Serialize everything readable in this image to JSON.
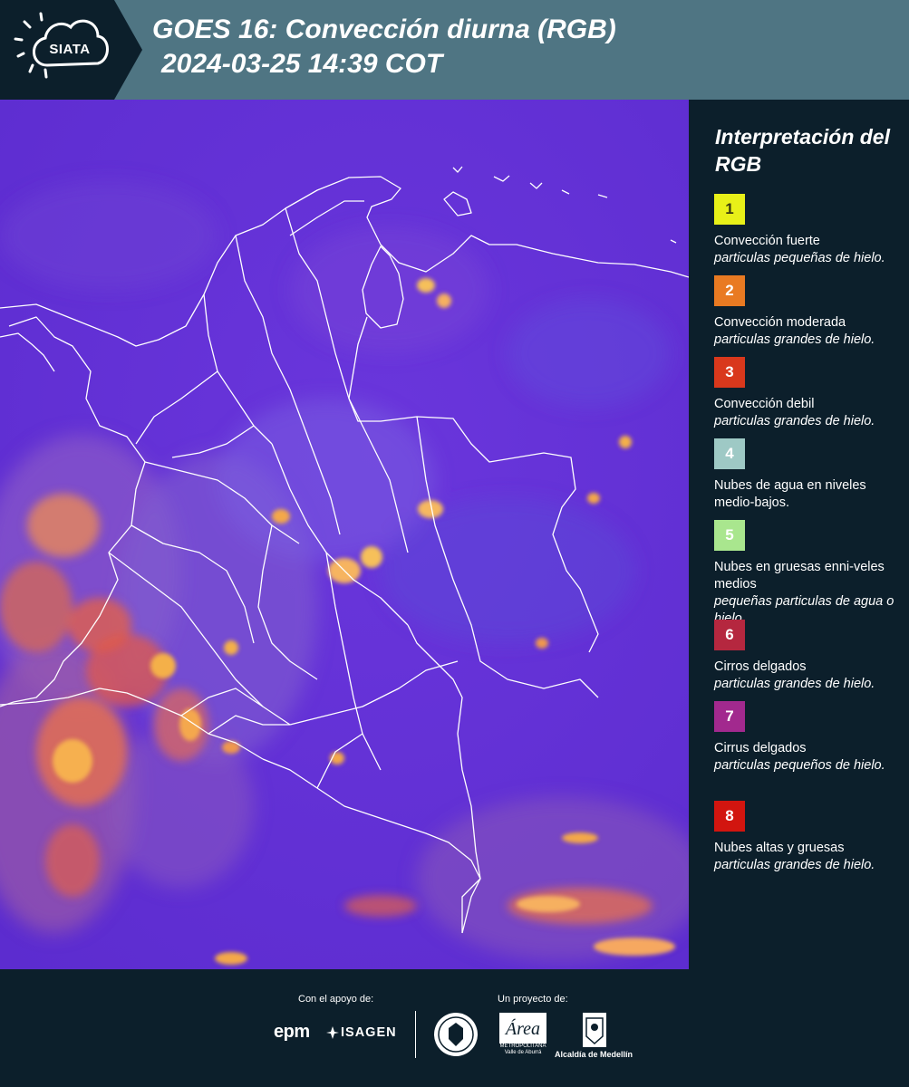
{
  "header": {
    "logo_text": "SIATA",
    "title_line1": "GOES 16: Convección diurna (RGB)",
    "title_line2": "2024-03-25 14:39 COT"
  },
  "map": {
    "background_color": "#6630d8",
    "border_color": "#ffffff",
    "icon": "satellite-rgb-composite-map"
  },
  "legend": {
    "title": "Interpretación del RGB",
    "items": [
      {
        "number": "1",
        "color": "#e8f018",
        "text_color": "#3a3a10",
        "label": "Convección fuerte",
        "sub": "particulas pequeñas de hielo."
      },
      {
        "number": "2",
        "color": "#e97a22",
        "text_color": "#ffffff",
        "label": "Convección moderada",
        "sub": "particulas grandes de hielo."
      },
      {
        "number": "3",
        "color": "#d9381c",
        "text_color": "#ffffff",
        "label": "Convección debil",
        "sub": "particulas grandes de hielo."
      },
      {
        "number": "4",
        "color": "#9ec9c5",
        "text_color": "#ffffff",
        "label": "Nubes de agua en niveles medio-bajos.",
        "sub": ""
      },
      {
        "number": "5",
        "color": "#a9e68e",
        "text_color": "#ffffff",
        "label": "Nubes en gruesas enni-veles medios",
        "sub": "pequeñas particulas de agua o hielo."
      },
      {
        "number": "6",
        "color": "#b5273f",
        "text_color": "#ffffff",
        "label": "Cirros delgados",
        "sub": "particulas grandes de hielo."
      },
      {
        "number": "7",
        "color": "#a2298e",
        "text_color": "#ffffff",
        "label": "Cirrus delgados",
        "sub": "particulas pequeños de hielo."
      },
      {
        "number": "8",
        "color": "#d2150f",
        "text_color": "#ffffff",
        "label": "Nubes altas y gruesas",
        "sub": "particulas grandes de hielo."
      }
    ]
  },
  "footer": {
    "support_label": "Con el apoyo de:",
    "project_label": "Un proyecto de:",
    "sponsor1": "epm",
    "sponsor2": "ISAGEN",
    "area_text": "METROPOLITANA Valle de Aburrá",
    "area_script": "Área",
    "alcaldia_text": "Alcaldía de Medellín"
  }
}
